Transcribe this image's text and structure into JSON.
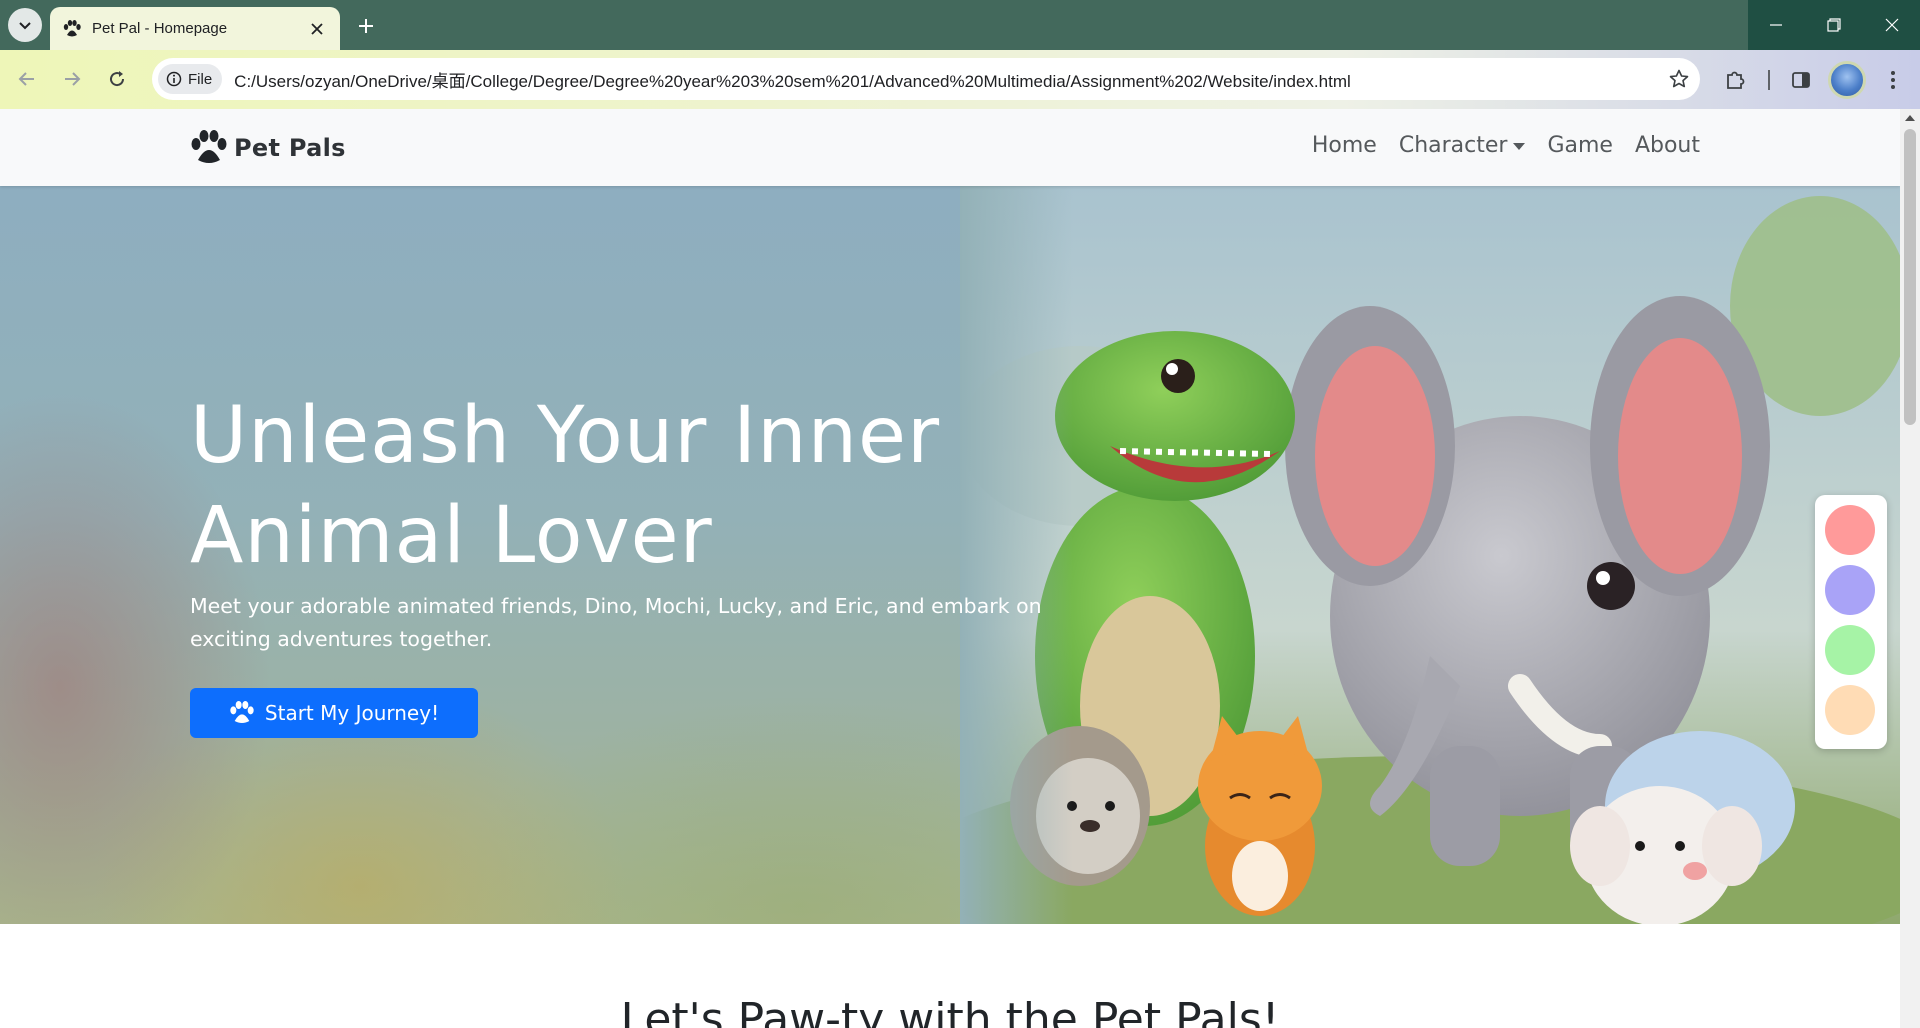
{
  "browser": {
    "tab_title": "Pet Pal - Homepage",
    "url_chip": "File",
    "url": "C:/Users/ozyan/OneDrive/桌面/College/Degree/Degree%20year%203%20sem%201/Advanced%20Multimedia/Assignment%202/Website/index.html"
  },
  "navbar": {
    "brand": "Pet Pals",
    "links": [
      "Home",
      "Character",
      "Game",
      "About"
    ]
  },
  "hero": {
    "title_line1": "Unleash Your Inner",
    "title_line2": "Animal Lover",
    "subtitle": "Meet your adorable animated friends, Dino, Mochi, Lucky, and Eric, and embark on exciting adventures together.",
    "cta_label": "Start My Journey!"
  },
  "theme_palette": {
    "colors": [
      "#ff9a9a",
      "#a9a3f7",
      "#a6f3a6",
      "#ffdcb5"
    ]
  },
  "section": {
    "heading": "Let's Paw-ty with the Pet Pals!"
  }
}
